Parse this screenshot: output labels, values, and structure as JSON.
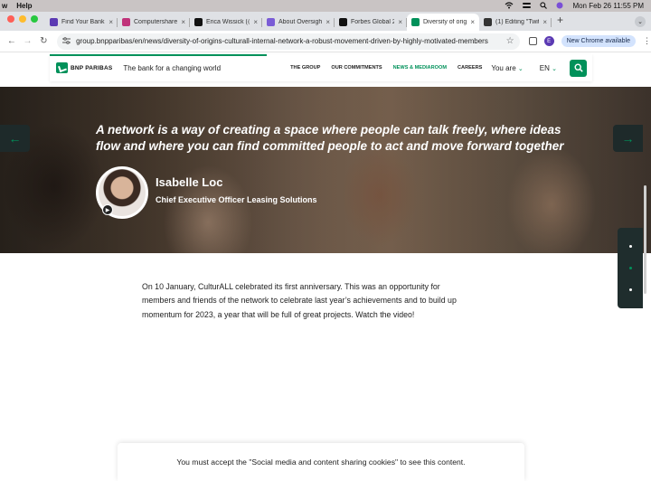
{
  "menubar": {
    "app_menu": "w",
    "help": "Help",
    "datetime": "Mon Feb 26  11:55 PM"
  },
  "tabs": [
    {
      "title": "Find Your Bank |",
      "favicon_color": "#5b3ab3"
    },
    {
      "title": "Computershare",
      "favicon_color": "#c0337a"
    },
    {
      "title": "Erica Wissick (@",
      "favicon_color": "#111111"
    },
    {
      "title": "About Oversight",
      "favicon_color": "#7a5cd6"
    },
    {
      "title": "Forbes Global 2",
      "favicon_color": "#111111"
    },
    {
      "title": "Diversity of origi",
      "favicon_color": "#00915a",
      "active": true
    },
    {
      "title": "(1) Editing \"Twit",
      "favicon_color": "#333333"
    }
  ],
  "addressbar": {
    "url": "group.bnpparibas/en/news/diversity-of-origins-culturall-internal-network-a-robust-movement-driven-by-highly-motivated-members",
    "profile_initial": "E",
    "update_label": "New Chrome available"
  },
  "site": {
    "brand": "BNP PARIBAS",
    "tagline": "The bank for a changing world",
    "nav": [
      "THE GROUP",
      "OUR COMMITMENTS",
      "NEWS & MEDIAROOM",
      "CAREERS"
    ],
    "active_nav_index": 2,
    "you_are": "You are",
    "language": "EN",
    "accent_color": "#00915a"
  },
  "hero": {
    "quote": "A network is a way of creating a space where people can talk freely, where ideas flow and where you can find committed people to act and move forward together",
    "person_name": "Isabelle Loc",
    "person_role": "Chief Executive Officer Leasing Solutions"
  },
  "article": {
    "paragraph": "On 10 January, CulturALL celebrated its first anniversary. This was an opportunity for members and friends of the network to celebrate last year’s achievements and to build up momentum for 2023, a year that will be full of great projects. Watch the video!"
  },
  "cookie_notice": "You must accept the \"Social media and content sharing cookies\" to see this content.",
  "pagination": {
    "count": 3,
    "active_index": 1
  }
}
